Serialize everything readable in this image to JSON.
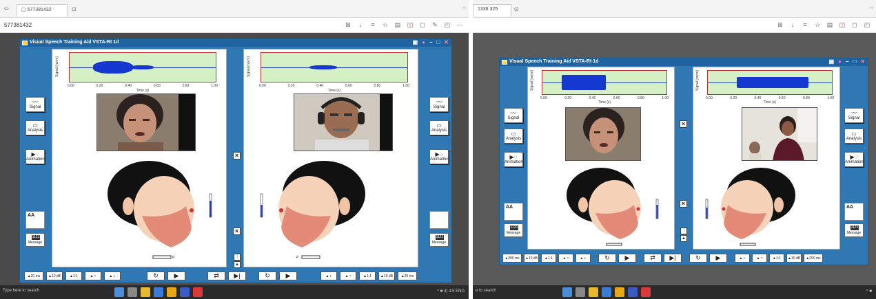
{
  "left": {
    "browser": {
      "tab_label": "577381432",
      "address": "577381432"
    },
    "app_title": "Visual Speech Training Aid VSTA-Rt 1d",
    "panels": [
      {
        "ylabel": "Signal (norm)",
        "xlabel": "Time (s)",
        "xticks": [
          "0.00",
          "0.20",
          "0.40",
          "0.60",
          "0.80",
          "1.00"
        ]
      },
      {
        "ylabel": "Signal (norm)",
        "xlabel": "Time (s)",
        "xticks": [
          "0.00",
          "0.20",
          "0.40",
          "0.60",
          "0.80",
          "1.00"
        ]
      }
    ],
    "side_buttons": {
      "signal": "Signal",
      "analysis": "Analysis",
      "animation": "Animation",
      "aa": "AA",
      "message": "Message",
      "message_icon": "1121"
    },
    "bottom_bar": [
      "20 ms",
      "10 dB",
      "1:1",
      "1:1",
      "10 dB",
      "20 ms"
    ],
    "taskbar": {
      "search": "Type here to search",
      "tray": "^ ■ 4) 3:5 ENG"
    }
  },
  "right": {
    "browser": {
      "tab_label": "1338 325",
      "address": ""
    },
    "app_title": "Visual Speech Training Aid VSTA-Rt 1d",
    "panels": [
      {
        "ylabel": "Signal (norm)",
        "xlabel": "Time (s)",
        "xticks": [
          "0.00",
          "0.20",
          "0.40",
          "0.60",
          "0.80",
          "1.00"
        ]
      },
      {
        "ylabel": "Signal (norm)",
        "xlabel": "Time (s)",
        "xticks": [
          "0.00",
          "0.20",
          "0.40",
          "0.60",
          "0.80",
          "1.00"
        ]
      }
    ],
    "side_buttons": {
      "signal": "Signal",
      "analysis": "Analysis",
      "animation": "Animation",
      "aa": "AA",
      "message": "Message",
      "message_icon": "1121"
    },
    "bottom_bar": [
      "200 ms",
      "10 dB",
      "1:1",
      "1:1",
      "10 dB",
      "200 ms"
    ],
    "taskbar": {
      "search": "e to search",
      "tray": "^ ■"
    }
  },
  "colors": {
    "app_bg": "#2f78b4",
    "plot_bg": "#d6f0c6",
    "wave": "#1438d0",
    "plot_border": "#c03030"
  }
}
